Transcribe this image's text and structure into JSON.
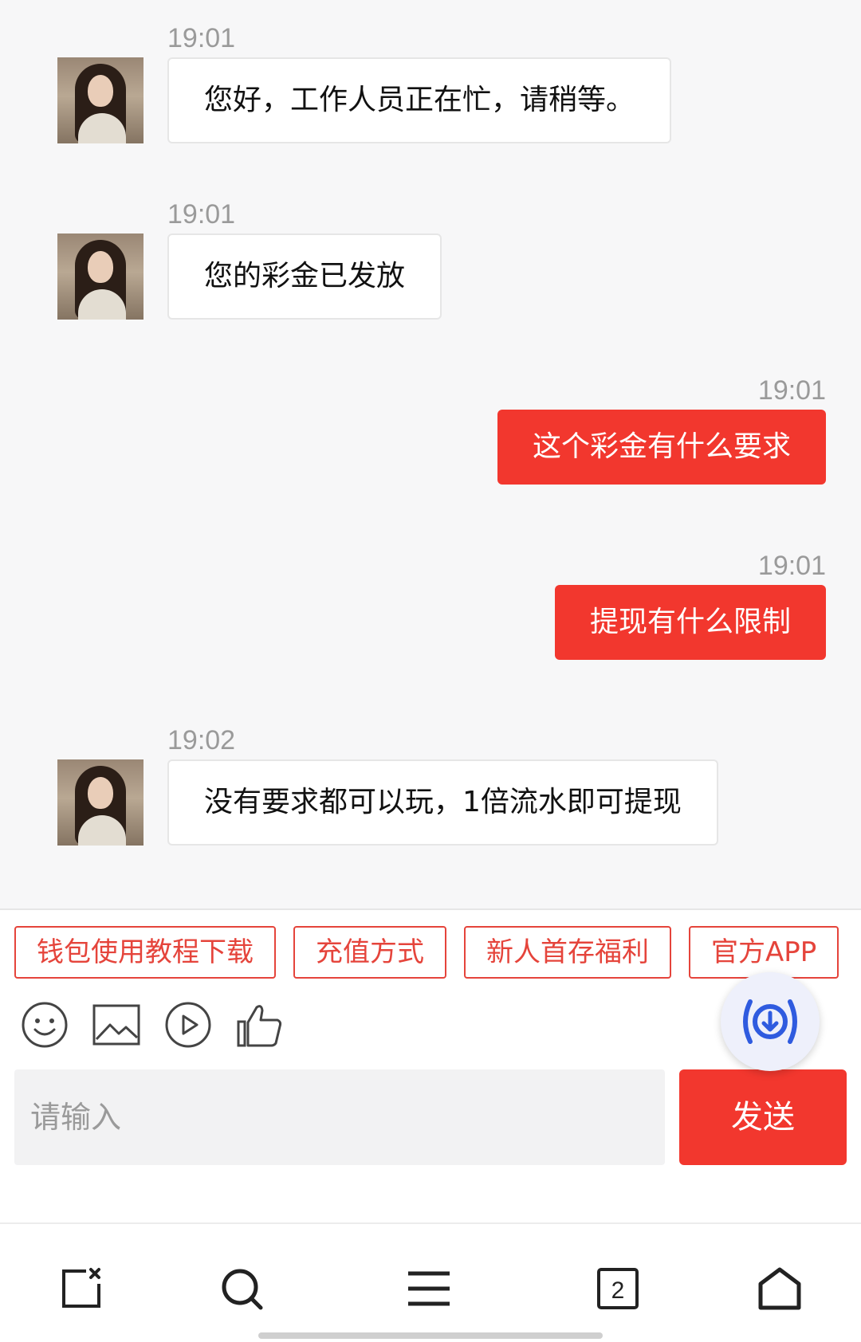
{
  "messages": [
    {
      "side": "left",
      "time": "19:01",
      "text": "您好，工作人员正在忙，请稍等。"
    },
    {
      "side": "left",
      "time": "19:01",
      "text": "您的彩金已发放"
    },
    {
      "side": "right",
      "time": "19:01",
      "text": "这个彩金有什么要求"
    },
    {
      "side": "right",
      "time": "19:01",
      "text": "提现有什么限制"
    },
    {
      "side": "left",
      "time": "19:02",
      "text": "没有要求都可以玩，1倍流水即可提现"
    }
  ],
  "quick_replies": [
    "钱包使用教程下载",
    "充值方式",
    "新人首存福利",
    "官方APP"
  ],
  "toolbar": {
    "icons": [
      "emoji-icon",
      "image-icon",
      "video-icon",
      "thumbs-up-icon"
    ]
  },
  "input": {
    "placeholder": "请输入",
    "value": ""
  },
  "send_label": "发送",
  "nav": {
    "tabs_count": "2"
  },
  "colors": {
    "accent": "#f2372e",
    "outline": "#e5443b",
    "float_blue": "#2f5bdf"
  }
}
